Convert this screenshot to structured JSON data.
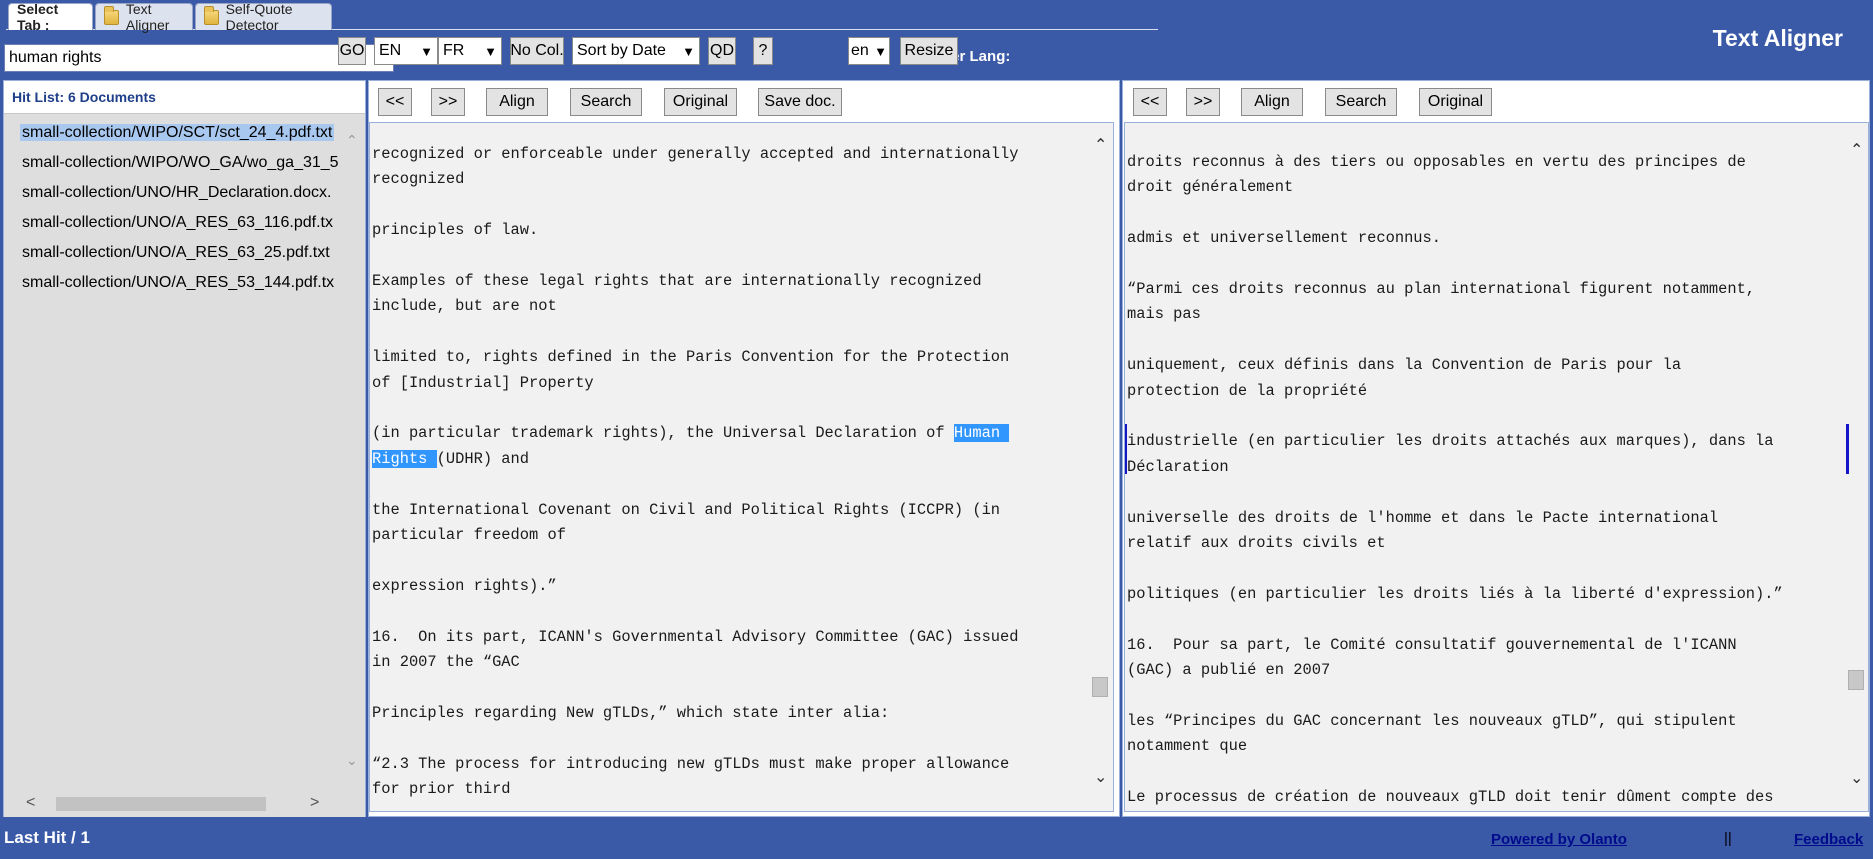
{
  "tabs": [
    {
      "label": "Select Tab :"
    },
    {
      "label": "Text Aligner",
      "icon": "folder-icon"
    },
    {
      "label": "Self-Quote Detector",
      "icon": "folder-icon"
    }
  ],
  "header": {
    "title": "Text Aligner"
  },
  "toolbar": {
    "search_value": "human rights",
    "go_label": "GO",
    "source_lang": "EN",
    "target_lang": "FR",
    "nocol_label": "No Col.",
    "sort_value": "Sort by Date",
    "qd_label": "QD",
    "help_label": "?",
    "user_lang_label": "User Lang:",
    "user_lang_value": "en",
    "resize_label": "Resize"
  },
  "hitlist": {
    "title": "Hit List: 6 Documents",
    "items": [
      "small-collection/WIPO/SCT/sct_24_4.pdf.txt",
      "small-collection/WIPO/WO_GA/wo_ga_31_5",
      "small-collection/UNO/HR_Declaration.docx.",
      "small-collection/UNO/A_RES_63_116.pdf.tx",
      "small-collection/UNO/A_RES_63_25.pdf.txt",
      "small-collection/UNO/A_RES_53_144.pdf.tx"
    ]
  },
  "source_panel": {
    "buttons": {
      "prev": "<<",
      "next": ">>",
      "align": "Align",
      "search": "Search",
      "original": "Original",
      "save": "Save doc."
    },
    "paragraphs": [
      [
        "recognized or enforceable under generally accepted and internationally",
        "recognized"
      ],
      [
        "principles of law."
      ],
      [
        "Examples of these legal rights that are internationally recognized",
        "include, but are not"
      ],
      [
        "limited to, rights defined in the Paris Convention for the Protection",
        "of [Industrial] Property"
      ],
      [
        "the International Covenant on Civil and Political Rights (ICCPR) (in",
        "particular freedom of"
      ],
      [
        "expression rights).”"
      ],
      [
        "16.  On its part, ICANN's Governmental Advisory Committee (GAC) issued",
        "in 2007 the “GAC"
      ],
      [
        "Principles regarding New gTLDs,” which state inter alia:"
      ],
      [
        "“2.3 The process for introducing new gTLDs must make proper allowance",
        "for prior third"
      ]
    ],
    "highlight_para": {
      "before": "(in particular trademark rights), the Universal Declaration of ",
      "hl1": "Human ",
      "hl2": "Rights ",
      "after": "(UDHR) and"
    }
  },
  "target_panel": {
    "buttons": {
      "prev": "<<",
      "next": ">>",
      "align": "Align",
      "search": "Search",
      "original": "Original"
    },
    "paragraphs": [
      [
        "droits reconnus à des tiers ou opposables en vertu des principes de",
        "droit généralement"
      ],
      [
        "admis et universellement reconnus."
      ],
      [
        "“Parmi ces droits reconnus au plan international figurent notamment,",
        "mais pas"
      ],
      [
        "uniquement, ceux définis dans la Convention de Paris pour la",
        "protection de la propriété"
      ],
      [
        "industrielle (en particulier les droits attachés aux marques), dans la",
        "Déclaration"
      ],
      [
        "universelle des droits de l'homme et dans le Pacte international",
        "relatif aux droits civils et"
      ],
      [
        "politiques (en particulier les droits liés à la liberté d'expression).”"
      ],
      [
        "16.  Pour sa part, le Comité consultatif gouvernemental de l'ICANN",
        "(GAC) a publié en 2007"
      ],
      [
        "les “Principes du GAC concernant les nouveaux gTLD”, qui stipulent",
        "notamment que"
      ],
      [
        "Le processus de création de nouveaux gTLD doit tenir dûment compte des"
      ]
    ]
  },
  "footer": {
    "last_hit": "Last Hit / 1",
    "powered": "Powered by Olanto",
    "separator": "||",
    "feedback": "Feedback"
  },
  "colors": {
    "header_bg": "#3a5aa8",
    "highlight": "#3296ff",
    "align_marker": "#1414c8"
  }
}
